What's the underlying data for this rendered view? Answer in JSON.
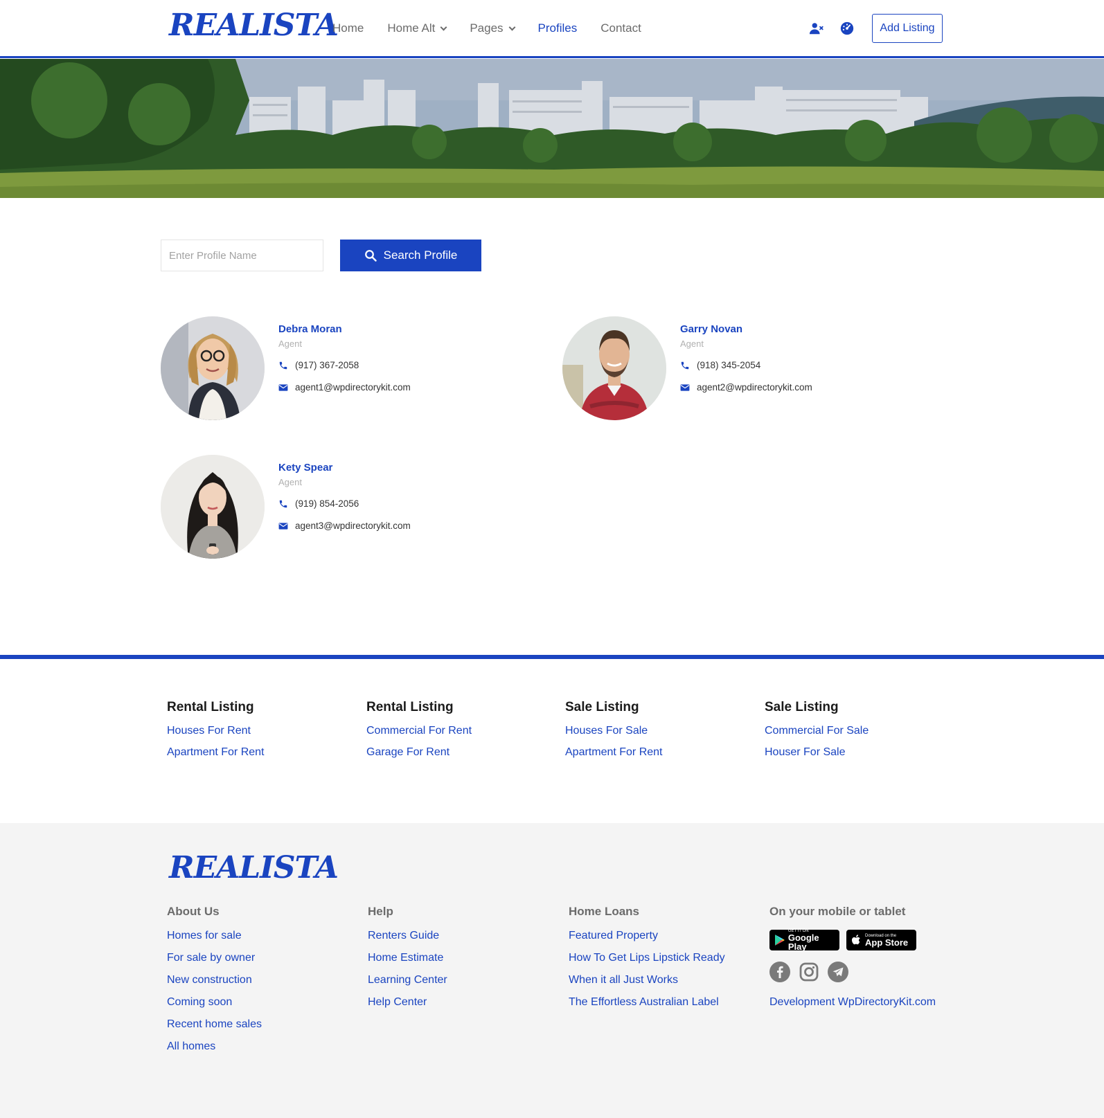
{
  "brand": {
    "logo_text": "REALISTA",
    "accent": "#1a44c0"
  },
  "nav": {
    "items": [
      {
        "label": "Home",
        "dropdown": false,
        "active": false
      },
      {
        "label": "Home Alt",
        "dropdown": true,
        "active": false
      },
      {
        "label": "Pages",
        "dropdown": true,
        "active": false
      },
      {
        "label": "Profiles",
        "dropdown": false,
        "active": true
      },
      {
        "label": "Contact",
        "dropdown": false,
        "active": false
      }
    ],
    "icons": [
      "user-x-icon",
      "dashboard-icon"
    ],
    "add_listing_label": "Add Listing"
  },
  "search": {
    "placeholder": "Enter Profile Name",
    "button_label": "Search Profile"
  },
  "profiles": [
    {
      "name": "Debra Moran",
      "role": "Agent",
      "phone": "(917) 367-2058",
      "email": "agent1@wpdirectorykit.com"
    },
    {
      "name": "Garry Novan",
      "role": "Agent",
      "phone": "(918) 345-2054",
      "email": "agent2@wpdirectorykit.com"
    },
    {
      "name": "Kety Spear",
      "role": "Agent",
      "phone": "(919) 854-2056",
      "email": "agent3@wpdirectorykit.com"
    }
  ],
  "listings": [
    {
      "title": "Rental Listing",
      "links": [
        "Houses For Rent",
        "Apartment For Rent"
      ]
    },
    {
      "title": "Rental Listing",
      "links": [
        "Commercial For Rent",
        "Garage For Rent"
      ]
    },
    {
      "title": "Sale Listing",
      "links": [
        "Houses For Sale",
        "Apartment For Rent"
      ]
    },
    {
      "title": "Sale Listing",
      "links": [
        "Commercial For Sale",
        "Houser For Sale"
      ]
    }
  ],
  "footer": {
    "logo_text": "REALISTA",
    "columns": [
      {
        "title": "About Us",
        "links": [
          "Homes for sale",
          "For sale by owner",
          "New construction",
          "Coming soon",
          "Recent home sales",
          "All homes"
        ]
      },
      {
        "title": "Help",
        "links": [
          "Renters Guide",
          "Home Estimate",
          "Learning Center",
          "Help Center"
        ]
      },
      {
        "title": "Home Loans",
        "links": [
          "Featured Property",
          "How To Get Lips Lipstick Ready",
          "When it all Just Works",
          "The Effortless Australian Label"
        ]
      }
    ],
    "mobile": {
      "title": "On your mobile or tablet",
      "google_small": "GET IT ON",
      "google_big": "Google Play",
      "apple_small": "Download on the",
      "apple_big": "App Store",
      "socials": [
        "facebook-icon",
        "instagram-icon",
        "telegram-icon"
      ],
      "dev_link": "Development WpDirectoryKit.com"
    }
  }
}
